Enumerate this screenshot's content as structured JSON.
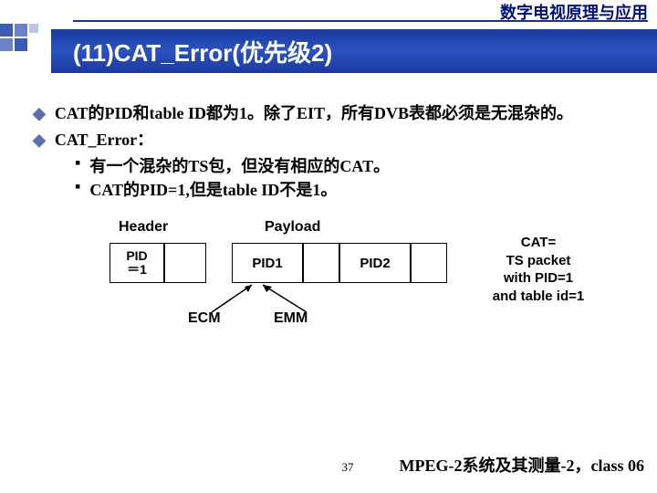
{
  "header": {
    "course": "数字电视原理与应用",
    "title": "(11)CAT_Error(优先级2)"
  },
  "bullets": {
    "b1": "CAT的PID和table ID都为1。除了EIT，所有DVB表都必须是无混杂的。",
    "b2": "CAT_Error：",
    "s1": "有一个混杂的TS包，但没有相应的CAT。",
    "s2": "CAT的PID=1,但是table ID不是1。"
  },
  "diagram": {
    "header_label": "Header",
    "payload_label": "Payload",
    "pid_l1": "PID",
    "pid_l2": "＝1",
    "pid1": "PID1",
    "pid2": "PID2",
    "ecm": "ECM",
    "emm": "EMM",
    "cat_l1": "CAT=",
    "cat_l2": "TS packet",
    "cat_l3": "with PID=1",
    "cat_l4": "and table id=1"
  },
  "footer": {
    "page": "37",
    "text": "MPEG-2系统及其测量-2，class 06"
  }
}
